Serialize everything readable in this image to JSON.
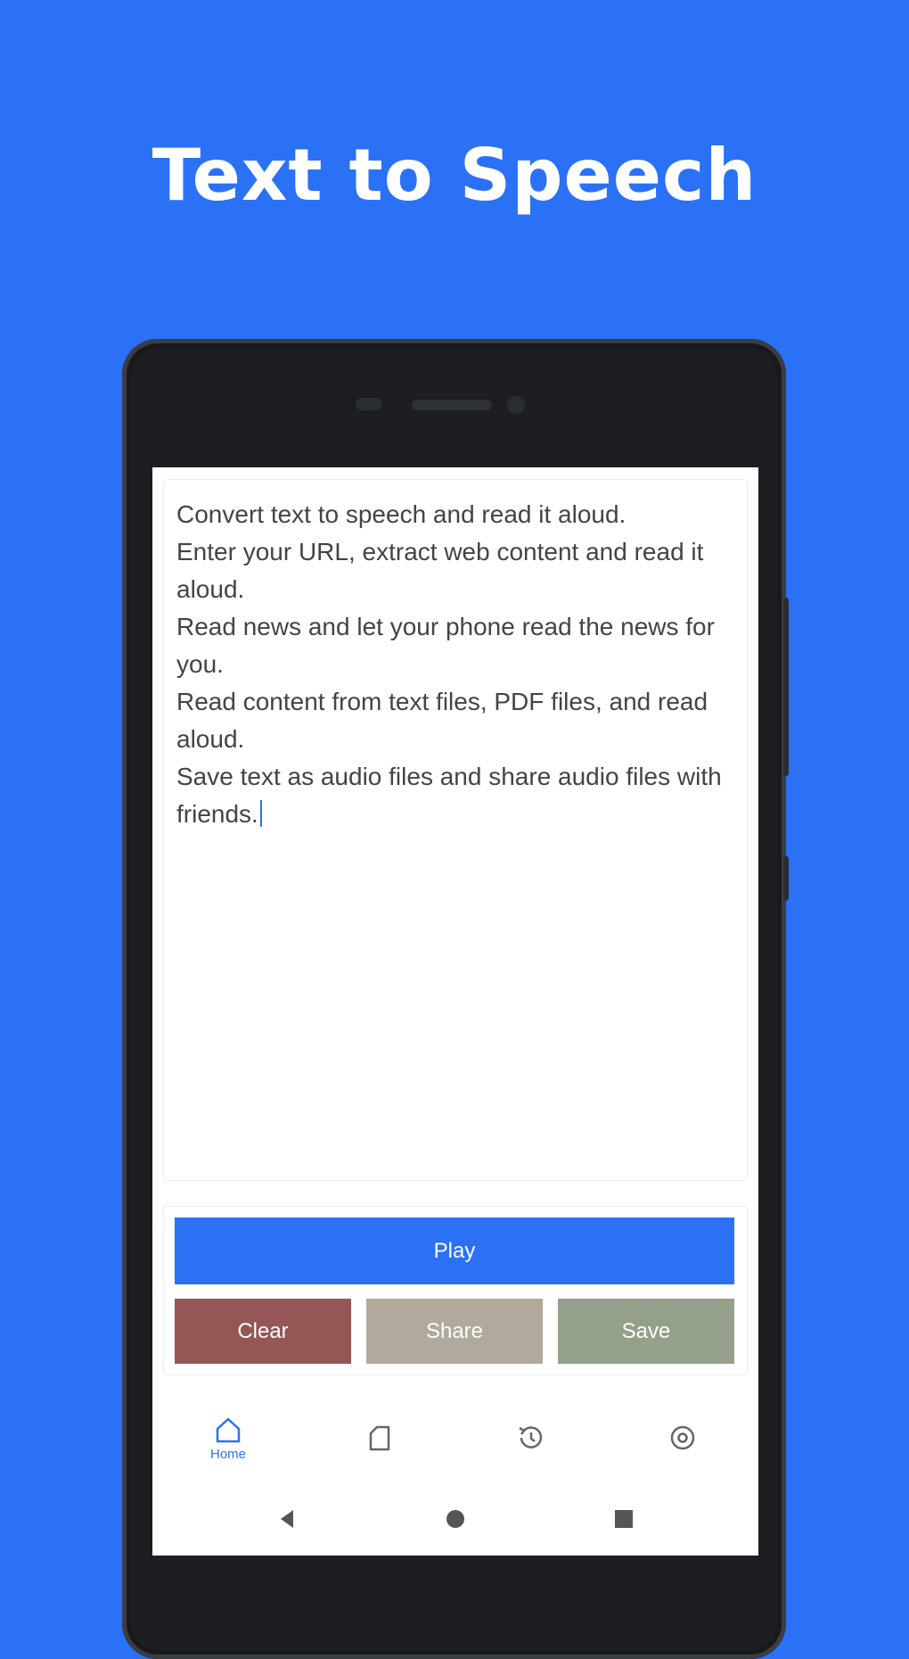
{
  "headline": "Text to Speech",
  "editor": {
    "lines": [
      "Convert text to speech and read it aloud.",
      "Enter your URL, extract web content and read it aloud.",
      "Read news and let your phone read the news for you.",
      "Read content from text files, PDF files, and read aloud.",
      "Save text as audio files and share audio files with friends."
    ]
  },
  "buttons": {
    "play": "Play",
    "clear": "Clear",
    "share": "Share",
    "save": "Save"
  },
  "colors": {
    "background": "#2a71f6",
    "play": "#2a71f6",
    "clear": "#955656",
    "share": "#b1aa9c",
    "save": "#95a08a"
  },
  "tabs": [
    {
      "label": "Home",
      "icon": "home-icon",
      "active": true
    },
    {
      "icon": "file-icon"
    },
    {
      "icon": "history-icon"
    },
    {
      "icon": "settings-icon"
    }
  ],
  "system_nav": [
    "back-icon",
    "home-circle-icon",
    "recents-icon"
  ]
}
